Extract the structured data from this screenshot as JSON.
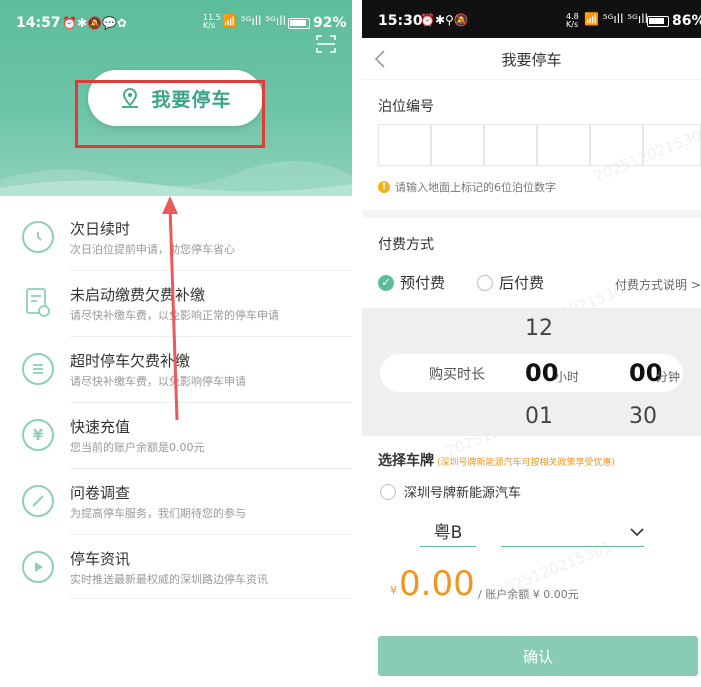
{
  "left": {
    "status": {
      "time": "14:57",
      "net_speed": "11.5",
      "net_unit": "K/s",
      "battery": "92%"
    },
    "park_button_label": "我要停车",
    "menu": [
      {
        "title": "次日续时",
        "subtitle": "次日泊位提前申请，助您停车省心",
        "icon": "clock-icon"
      },
      {
        "title": "未启动缴费欠费补缴",
        "subtitle": "请尽快补缴车费，以免影响正常的停车申请",
        "icon": "bill-icon"
      },
      {
        "title": "超时停车欠费补缴",
        "subtitle": "请尽快补缴车费，以免影响停车申请",
        "icon": "list-icon"
      },
      {
        "title": "快速充值",
        "subtitle": "您当前的账户余额是0.00元",
        "icon": "yen-icon"
      },
      {
        "title": "问卷调查",
        "subtitle": "为提高停车服务，我们期待您的参与",
        "icon": "pen-icon"
      },
      {
        "title": "停车资讯",
        "subtitle": "实时推送最新最权威的深圳路边停车资讯",
        "icon": "play-icon"
      }
    ],
    "annotation_color": "#e03b3b",
    "brand_color": "#5dbd9b"
  },
  "right": {
    "status": {
      "time": "15:30",
      "net_speed": "4.8",
      "net_unit": "K/s",
      "battery": "86%"
    },
    "nav_title": "我要停车",
    "berth_label": "泊位编号",
    "berth_hint": "请输入地面上标记的6位泊位数字",
    "pay_label": "付费方式",
    "prepay_label": "预付费",
    "postpay_label": "后付费",
    "pay_help": "付费方式说明",
    "pay_help_arrow": ">",
    "duration_label": "购买时长",
    "hours": {
      "prev": "12",
      "selected": "00",
      "next": "01",
      "unit": "小时"
    },
    "minutes": {
      "selected": "00",
      "next": "30",
      "unit": "分钟"
    },
    "plate_label": "选择车牌",
    "plate_note": "(深圳号牌新能源汽车可按相关政策享受优惠)",
    "plate_option": "深圳号牌新能源汽车",
    "plate_prefix": "粤B",
    "amount_symbol": "¥",
    "amount": "0.00",
    "balance_text": "/ 账户余额 ¥ 0.00元",
    "confirm_label": "确认",
    "watermark": "2025120215301"
  }
}
